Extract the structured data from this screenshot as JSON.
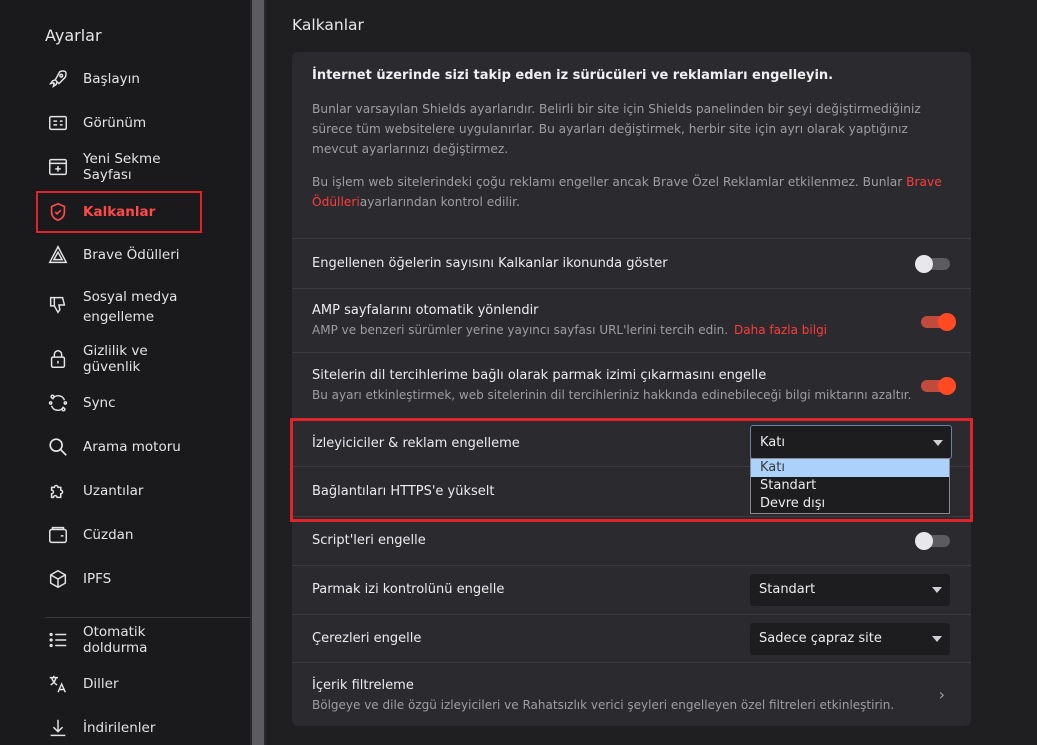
{
  "sidebar": {
    "title": "Ayarlar",
    "items": [
      {
        "label": "Başlayın",
        "icon": "rocket-icon"
      },
      {
        "label": "Görünüm",
        "icon": "appearance-icon"
      },
      {
        "label": "Yeni Sekme Sayfası",
        "icon": "new-tab-icon"
      },
      {
        "label": "Kalkanlar",
        "icon": "shield-icon"
      },
      {
        "label": "Brave Ödülleri",
        "icon": "rewards-triangle-icon"
      },
      {
        "label": "Sosyal medya engelleme",
        "line1": "Sosyal medya",
        "line2": "engelleme",
        "icon": "thumbs-down-icon"
      },
      {
        "label": "Gizlilik ve güvenlik",
        "icon": "lock-icon"
      },
      {
        "label": "Sync",
        "icon": "sync-icon"
      },
      {
        "label": "Arama motoru",
        "icon": "search-icon"
      },
      {
        "label": "Uzantılar",
        "icon": "puzzle-icon"
      },
      {
        "label": "Cüzdan",
        "icon": "wallet-icon"
      },
      {
        "label": "IPFS",
        "icon": "cube-icon"
      },
      {
        "label": "Otomatik doldurma",
        "icon": "list-icon"
      },
      {
        "label": "Diller",
        "icon": "translate-icon"
      },
      {
        "label": "İndirilenler",
        "icon": "download-icon"
      }
    ]
  },
  "main": {
    "title": "Kalkanlar",
    "intro": {
      "heading": "İnternet üzerinde sizi takip eden iz sürücüleri ve reklamları engelleyin.",
      "p1": "Bunlar varsayılan Shields ayarlarıdır. Belirli bir site için Shields panelinden bir şeyi değiştirmediğiniz sürece tüm websitelere uygulanırlar. Bu ayarları değiştirmek, herbir site için ayrı olarak yaptığınız mevcut ayarlarınızı değiştirmez.",
      "p2_before": "Bu işlem web sitelerindeki çoğu reklamı engeller ancak Brave Özel Reklamlar etkilenmez. Bunlar ",
      "p2_link": "Brave Ödülleri",
      "p2_after": "ayarlarından kontrol edilir."
    },
    "rows": {
      "count_badge": {
        "title": "Engellenen öğelerin sayısını Kalkanlar ikonunda göster",
        "on": false
      },
      "amp": {
        "title": "AMP sayfalarını otomatik yönlendir",
        "sub": "AMP ve benzeri sürümler yerine yayıncı sayfası URL'lerini tercih edin.",
        "link": "Daha fazla bilgi",
        "on": true
      },
      "language_fp": {
        "title": "Sitelerin dil tercihlerime bağlı olarak parmak izimi çıkarmasını engelle",
        "sub": "Bu ayarı etkinleştirmek, web sitelerinin dil tercihleriniz hakkında edinebileceği bilgi miktarını azaltır.",
        "on": true
      },
      "trackers": {
        "title": "İzleyiciciler & reklam engelleme",
        "value": "Katı"
      },
      "https": {
        "title": "Bağlantıları HTTPS'e yükselt"
      },
      "scripts": {
        "title": "Script'leri engelle",
        "on": false
      },
      "fingerprint": {
        "title": "Parmak izi kontrolünü engelle",
        "value": "Standart"
      },
      "cookies": {
        "title": "Çerezleri engelle",
        "value": "Sadece çapraz site"
      },
      "filters": {
        "title": "İçerik filtreleme",
        "sub": "Bölgeye ve dile özgü izleyicileri ve Rahatsızlık verici şeyleri engelleyen özel filtreleri etkinleştirin."
      }
    },
    "dropdown_options": [
      "Katı",
      "Standart",
      "Devre dışı"
    ]
  },
  "colors": {
    "accent": "#ff4a24",
    "highlight": "#e0242b",
    "link": "#ff3b3b"
  }
}
